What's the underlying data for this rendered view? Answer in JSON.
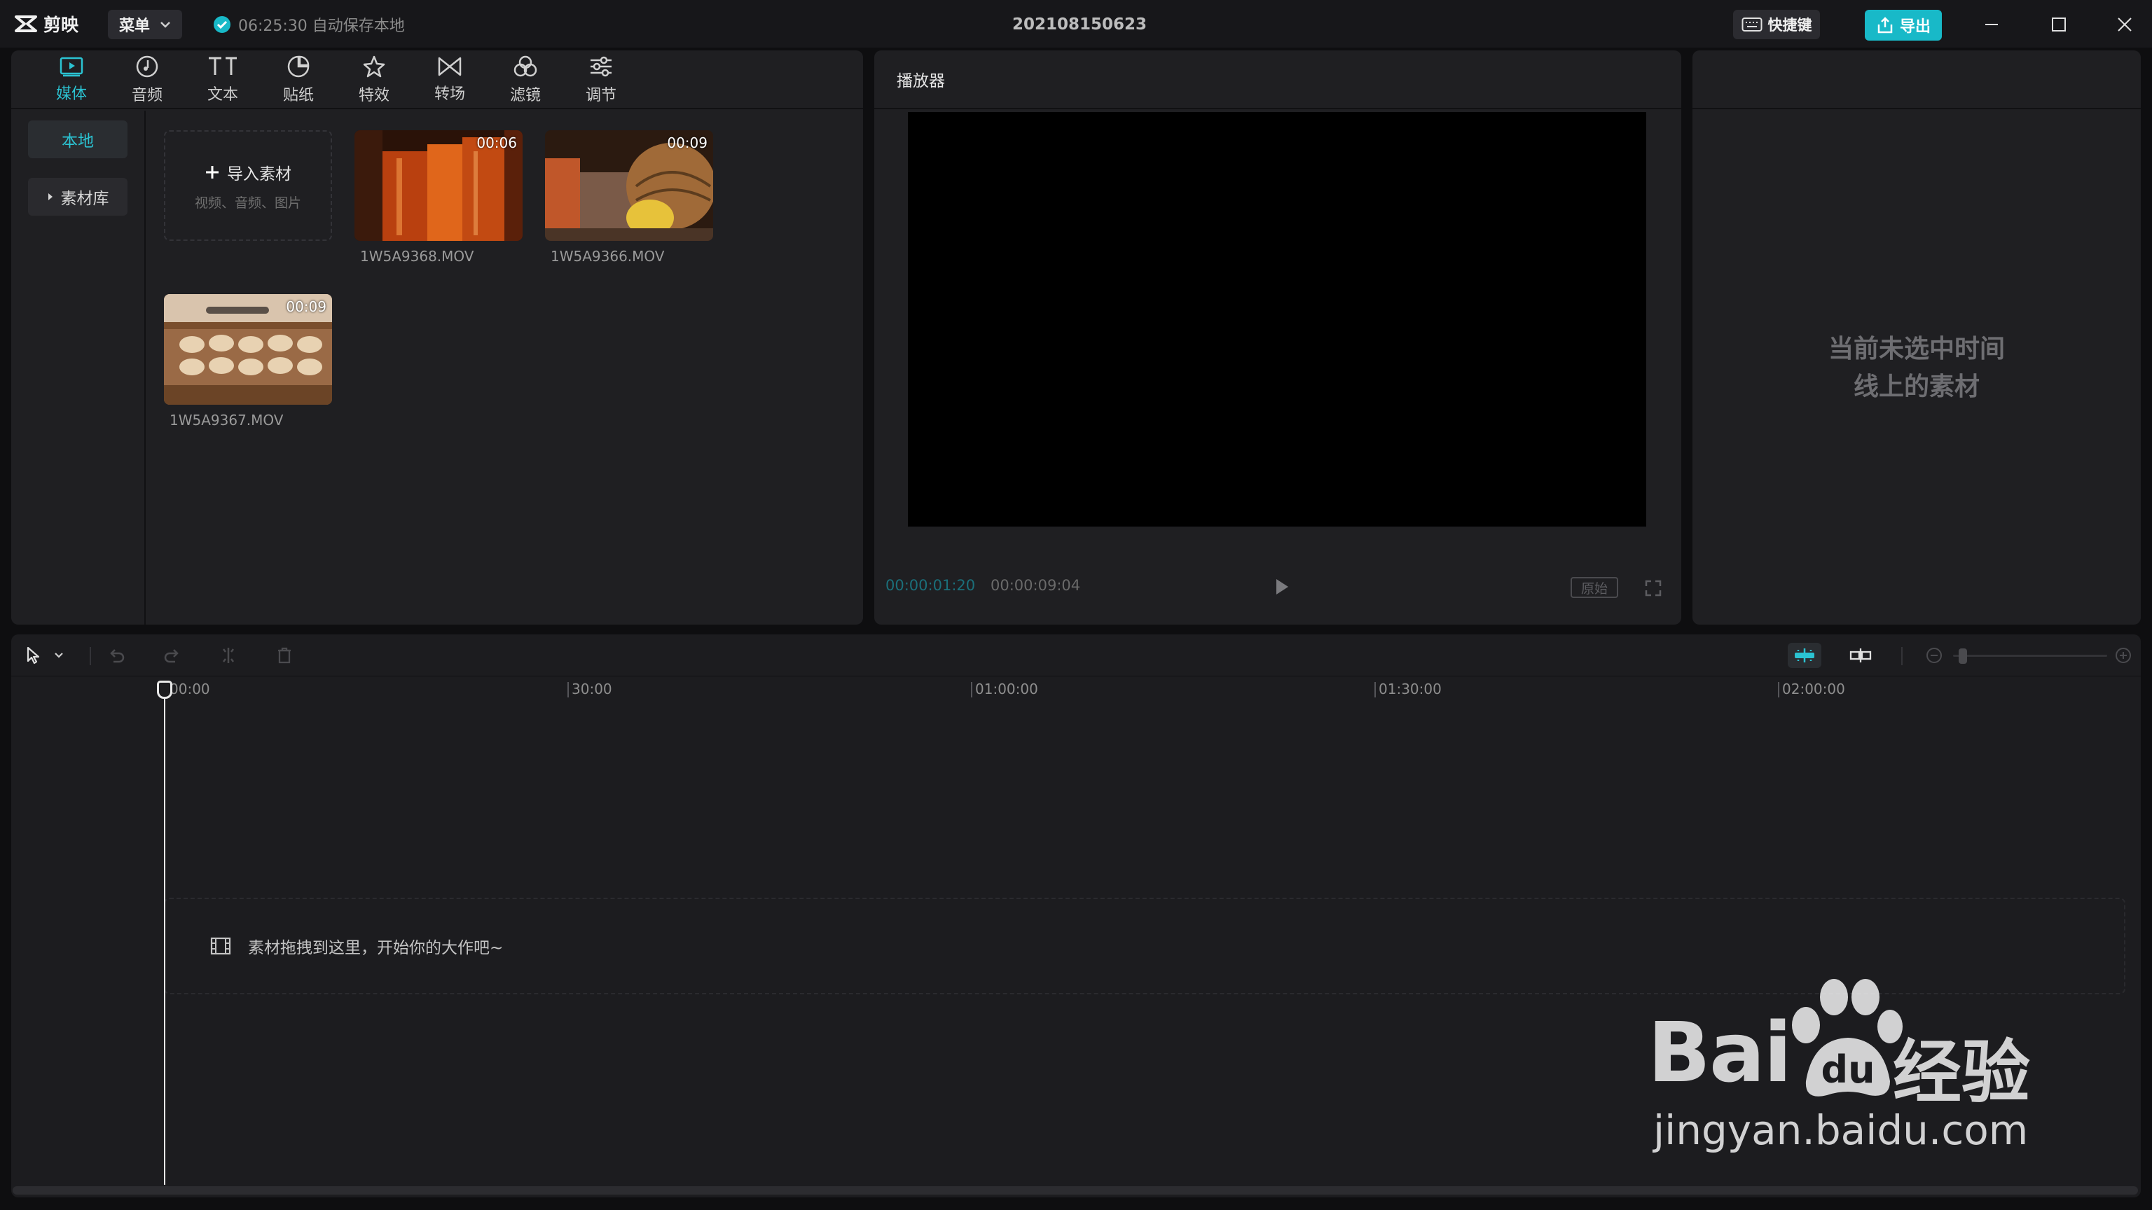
{
  "app": {
    "name": "剪映",
    "menu_label": "菜单",
    "save_status": "06:25:30 自动保存本地",
    "project_title": "202108150623",
    "shortcut_label": "快捷键",
    "export_label": "导出"
  },
  "media": {
    "tabs": [
      {
        "label": "媒体",
        "icon": "media-icon",
        "active": true
      },
      {
        "label": "音频",
        "icon": "audio-icon"
      },
      {
        "label": "文本",
        "icon": "text-icon"
      },
      {
        "label": "贴纸",
        "icon": "sticker-icon"
      },
      {
        "label": "特效",
        "icon": "effects-icon"
      },
      {
        "label": "转场",
        "icon": "transition-icon"
      },
      {
        "label": "滤镜",
        "icon": "filter-icon"
      },
      {
        "label": "调节",
        "icon": "adjust-icon"
      }
    ],
    "sidebar": {
      "local": "本地",
      "library": "素材库"
    },
    "import": {
      "label": "导入素材",
      "hint": "视频、音频、图片"
    },
    "clips": [
      {
        "name": "1W5A9368.MOV",
        "duration": "00:06"
      },
      {
        "name": "1W5A9366.MOV",
        "duration": "00:09"
      },
      {
        "name": "1W5A9367.MOV",
        "duration": "00:09"
      }
    ]
  },
  "player": {
    "title": "播放器",
    "current_time": "00:00:01:20",
    "total_time": "00:00:09:04",
    "ratio_label": "原始"
  },
  "properties": {
    "empty_line1": "当前未选中时间",
    "empty_line2": "线上的素材"
  },
  "timeline": {
    "ruler": [
      "00:00",
      "30:00",
      "01:00:00",
      "01:30:00",
      "02:00:00"
    ],
    "drop_hint": "素材拖拽到这里，开始你的大作吧~"
  },
  "watermark": {
    "brand": "Bai",
    "brand_cn": "经验",
    "url": "jingyan.baidu.com"
  },
  "colors": {
    "accent": "#2bc3d2",
    "export_bg": "#18b9c8",
    "panel": "#1f1f22",
    "background": "#0e0e10"
  }
}
